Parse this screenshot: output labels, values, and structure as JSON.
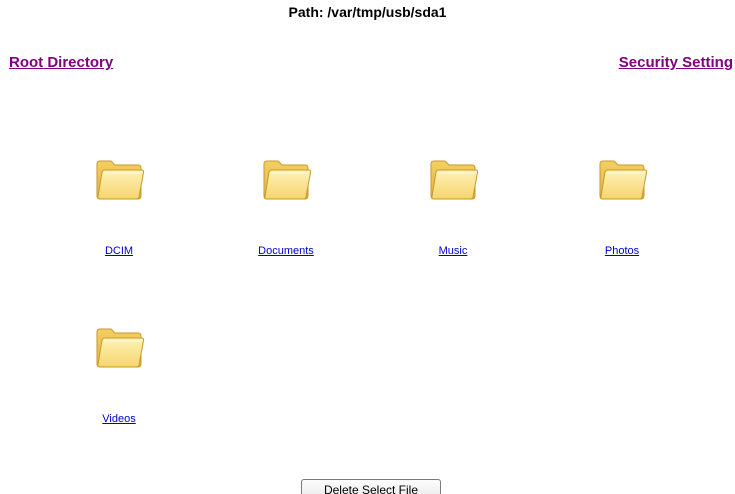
{
  "header": {
    "path_text": "Path: /var/tmp/usb/sda1"
  },
  "nav": {
    "root_directory": "Root Directory",
    "security_setting": "Security Setting"
  },
  "folders": [
    {
      "label": "DCIM",
      "icon": "folder-icon"
    },
    {
      "label": "Documents",
      "icon": "folder-icon"
    },
    {
      "label": "Music",
      "icon": "folder-icon"
    },
    {
      "label": "Photos",
      "icon": "folder-icon"
    },
    {
      "label": "Videos",
      "icon": "folder-icon"
    }
  ],
  "actions": {
    "delete_label": "Delete Select File"
  },
  "colors": {
    "visited_link": "#800080",
    "link": "#0000cc",
    "folder_fill": "#f7d66b",
    "folder_stroke": "#c79a2a"
  }
}
